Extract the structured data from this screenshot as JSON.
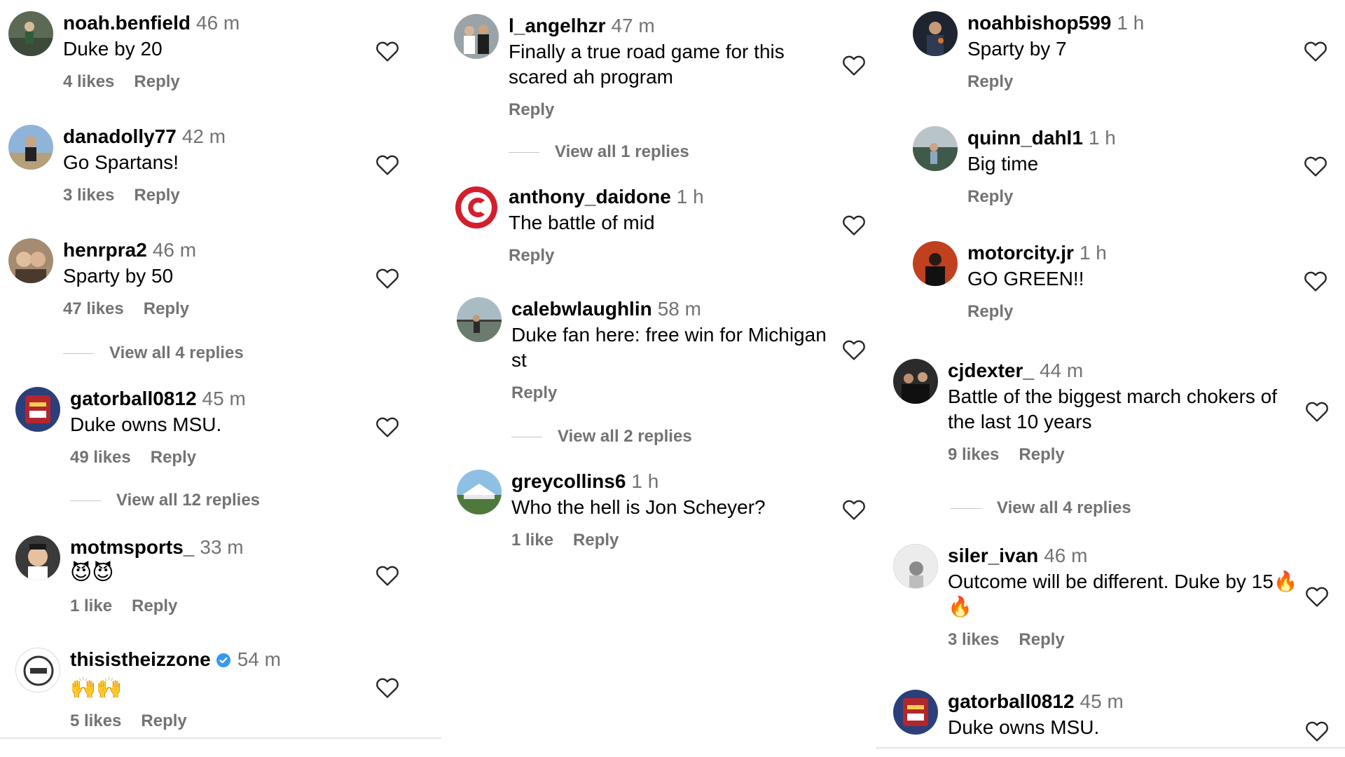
{
  "columns": [
    {
      "comments": [
        {
          "user": "noah.benfield",
          "time": "46 m",
          "text": "Duke by 20",
          "likes": "4 likes",
          "reply": "Reply"
        },
        {
          "user": "danadolly77",
          "time": "42 m",
          "text": "Go Spartans!",
          "likes": "3 likes",
          "reply": "Reply"
        },
        {
          "user": "henrpra2",
          "time": "46 m",
          "text": "Sparty by 50",
          "likes": "47 likes",
          "reply": "Reply",
          "view_replies": "View all 4 replies"
        },
        {
          "user": "gatorball0812",
          "time": "45 m",
          "text": "Duke owns MSU.",
          "likes": "49 likes",
          "reply": "Reply",
          "view_replies": "View all 12 replies"
        },
        {
          "user": "motmsports_",
          "time": "33 m",
          "text": "😈😈",
          "likes": "1 like",
          "reply": "Reply"
        },
        {
          "user": "thisistheizzone",
          "time": "54 m",
          "text": "🙌🙌",
          "likes": "5 likes",
          "reply": "Reply",
          "verified": true
        }
      ]
    },
    {
      "comments": [
        {
          "user": "l_angelhzr",
          "time": "47 m",
          "text": "Finally a true road game for this scared ah program",
          "reply": "Reply",
          "view_replies": "View all 1 replies"
        },
        {
          "user": "anthony_daidone",
          "time": "1 h",
          "text": "The battle of mid",
          "reply": "Reply"
        },
        {
          "user": "calebwlaughlin",
          "time": "58 m",
          "text": "Duke fan here: free win for Michigan st",
          "reply": "Reply",
          "view_replies": "View all 2 replies"
        },
        {
          "user": "greycollins6",
          "time": "1 h",
          "text": "Who the hell is Jon Scheyer?",
          "likes": "1 like",
          "reply": "Reply"
        }
      ]
    },
    {
      "comments": [
        {
          "user": "noahbishop599",
          "time": "1 h",
          "text": "Sparty by 7",
          "reply": "Reply"
        },
        {
          "user": "quinn_dahl1",
          "time": "1 h",
          "text": "Big time",
          "reply": "Reply"
        },
        {
          "user": "motorcity.jr",
          "time": "1 h",
          "text": "GO GREEN!!",
          "reply": "Reply"
        },
        {
          "user": "cjdexter_",
          "time": "44 m",
          "text": "Battle of the biggest march chokers of the last 10 years",
          "likes": "9 likes",
          "reply": "Reply",
          "view_replies": "View all 4 replies"
        },
        {
          "user": "siler_ivan",
          "time": "46 m",
          "text": "Outcome will be different. Duke by 15🔥🔥",
          "likes": "3 likes",
          "reply": "Reply"
        },
        {
          "user": "gatorball0812",
          "time": "45 m",
          "text": "Duke owns MSU."
        }
      ]
    }
  ],
  "colors": {
    "meta_text": "#737373",
    "verified_badge": "#3897f0",
    "divider": "#e6e6e6"
  },
  "icons": {
    "like": "heart-outline-icon",
    "verified": "verified-badge-icon"
  }
}
